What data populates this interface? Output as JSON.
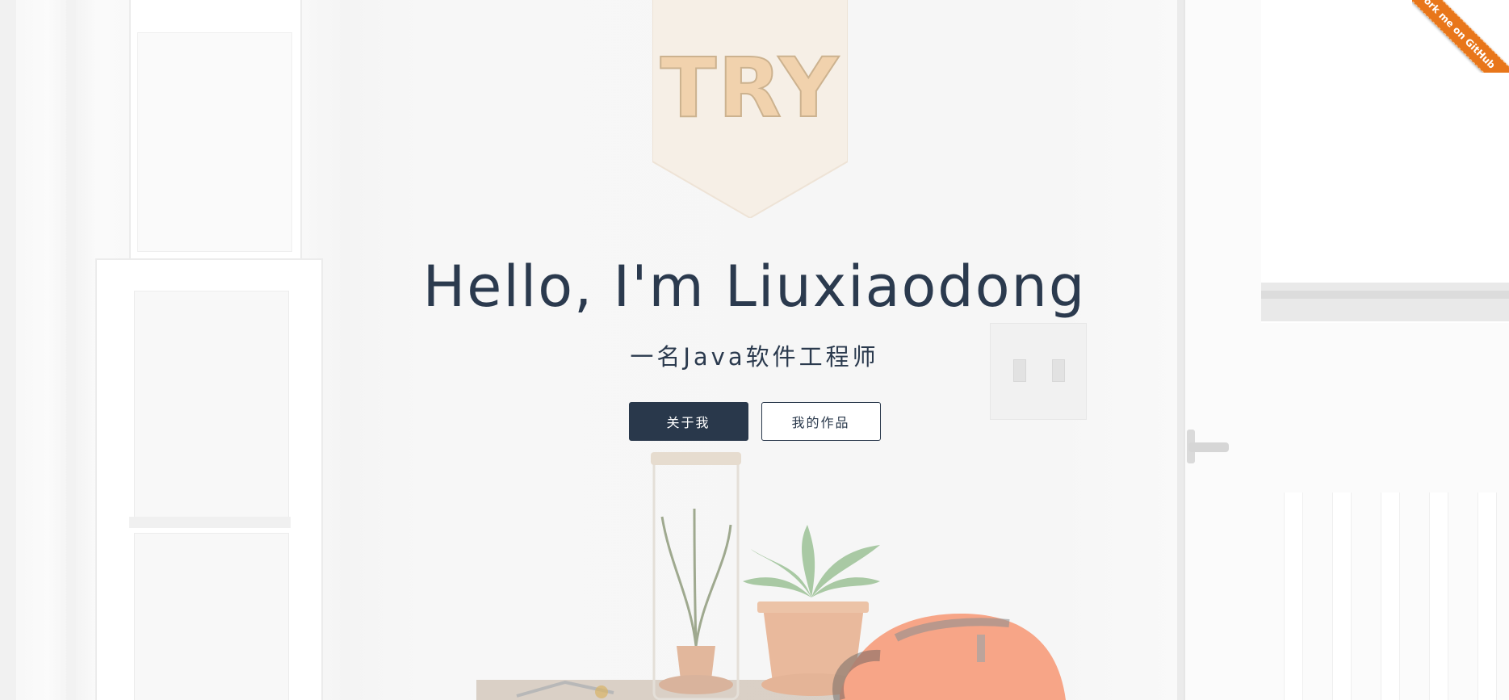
{
  "hero": {
    "title": "Hello, I'm Liuxiaodong",
    "subtitle": "一名Java软件工程师",
    "buttons": {
      "about": "关于我",
      "works": "我的作品"
    }
  },
  "background": {
    "pennant_text": "TRY"
  },
  "ribbon": {
    "label": "Fork me on GitHub"
  },
  "colors": {
    "primary": "#29384b",
    "ribbon": "#e8761a",
    "pennant": "#f1d2ad"
  }
}
